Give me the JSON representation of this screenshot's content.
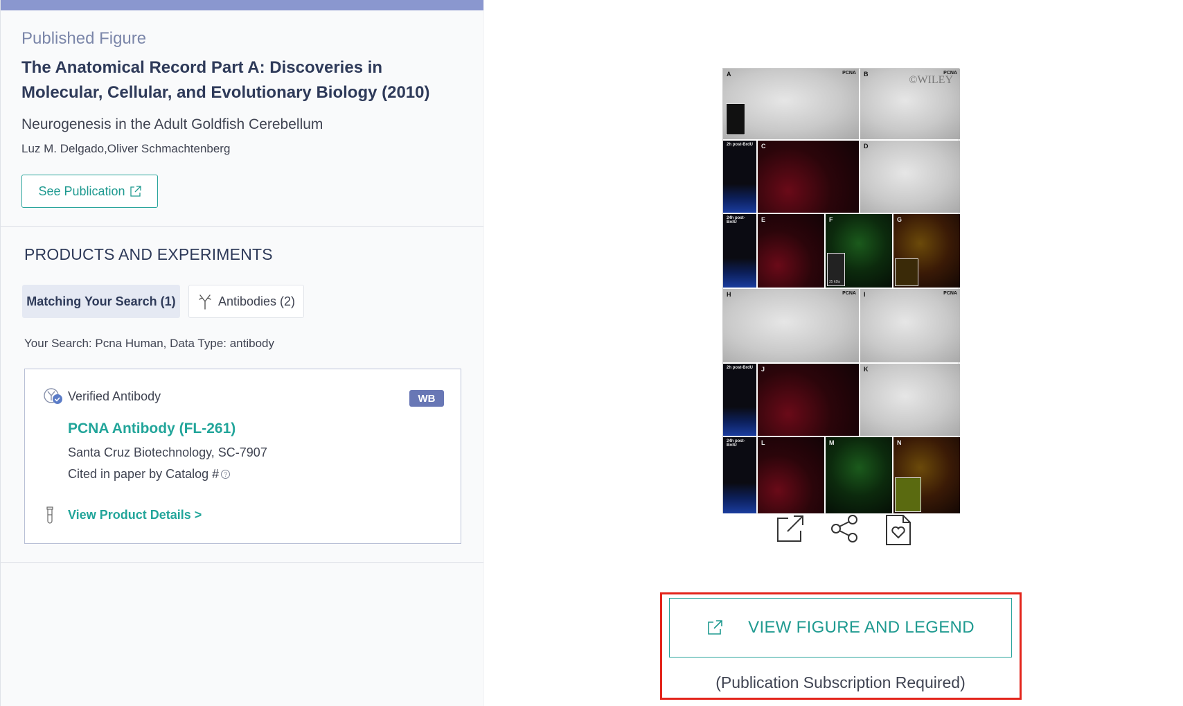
{
  "left": {
    "pub_label": "Published Figure",
    "journal": "The Anatomical Record Part A: Discoveries in Molecular, Cellular, and Evolutionary Biology  (2010)",
    "paper_title": "Neurogenesis in the Adult Goldfish Cerebellum",
    "authors": "Luz M. Delgado,Oliver Schmachtenberg",
    "see_publication": "See Publication",
    "section_title": "PRODUCTS AND EXPERIMENTS",
    "tabs": [
      {
        "label": "Matching Your Search (1)",
        "active": true
      },
      {
        "label": "Antibodies (2)",
        "active": false,
        "icon": "antibody-icon"
      }
    ],
    "your_search": "Your Search: Pcna Human, Data Type: antibody",
    "card": {
      "verified": "Verified Antibody",
      "badge": "WB",
      "product_name": "PCNA Antibody (FL-261)",
      "vendor": "Santa Cruz Biotechnology, SC-7907",
      "cited": "Cited in paper by Catalog #",
      "help_icon": "?",
      "view_details": "View Product Details >"
    }
  },
  "figure": {
    "panels": {
      "A": "A",
      "B": "B",
      "C": "C",
      "D": "D",
      "E": "E",
      "F": "F",
      "G": "G",
      "H": "H",
      "I": "I",
      "J": "J",
      "K": "K",
      "L": "L",
      "M": "M",
      "N": "N"
    },
    "pcna": "PCNA",
    "post_2h": "2h post-BrdU",
    "post_24h": "24h post-BrdU",
    "kda": "35 kDa",
    "watermark": "©WILEY",
    "icons": [
      "external-link-icon",
      "share-icon",
      "save-favorite-icon"
    ]
  },
  "cta": {
    "button": "VIEW FIGURE AND LEGEND",
    "note": "(Publication Subscription Required)"
  },
  "colors": {
    "accent": "#1f9a90",
    "top_bar": "#8a97cf",
    "badge": "#6877b5",
    "highlight": "#e3241b"
  }
}
